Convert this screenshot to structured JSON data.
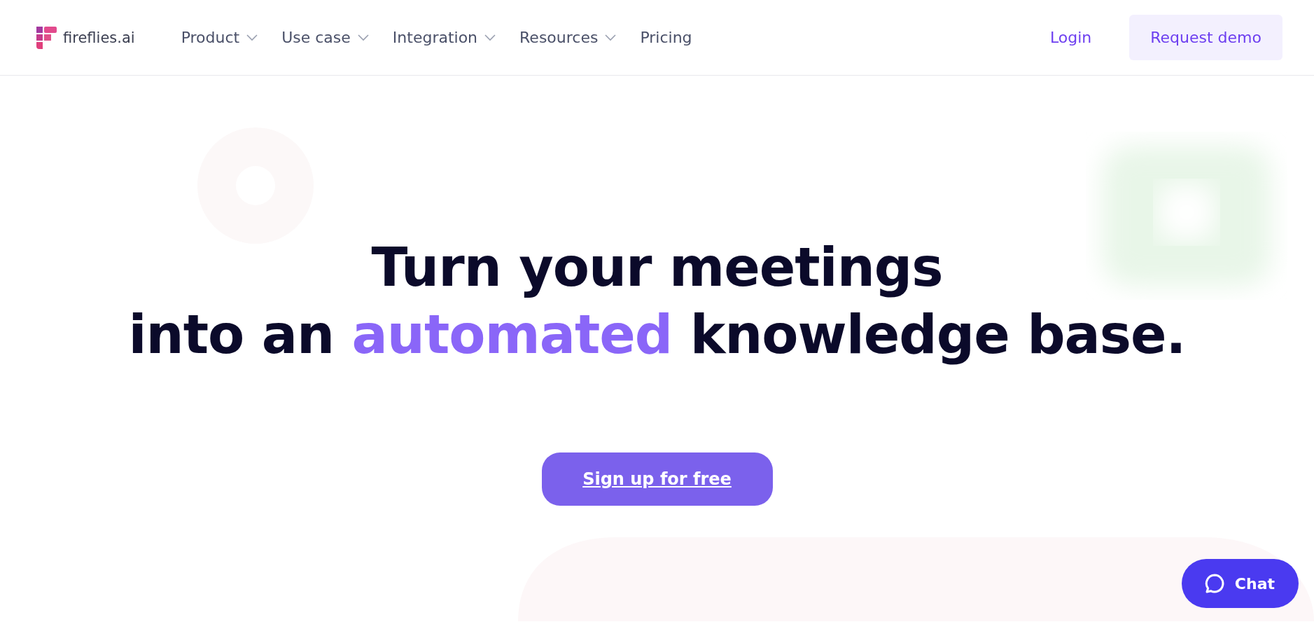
{
  "header": {
    "logo_text": "fireflies.ai",
    "nav": [
      {
        "label": "Product",
        "has_menu": true
      },
      {
        "label": "Use case",
        "has_menu": true
      },
      {
        "label": "Integration",
        "has_menu": true
      },
      {
        "label": "Resources",
        "has_menu": true
      },
      {
        "label": "Pricing",
        "has_menu": false
      }
    ],
    "login": "Login",
    "demo": "Request demo"
  },
  "hero": {
    "line1": "Turn your meetings",
    "line2_before": "into an",
    "line2_highlight": "automated",
    "line2_after": "knowledge base.",
    "cta": "Sign up for free"
  },
  "chat": {
    "label": "Chat"
  }
}
